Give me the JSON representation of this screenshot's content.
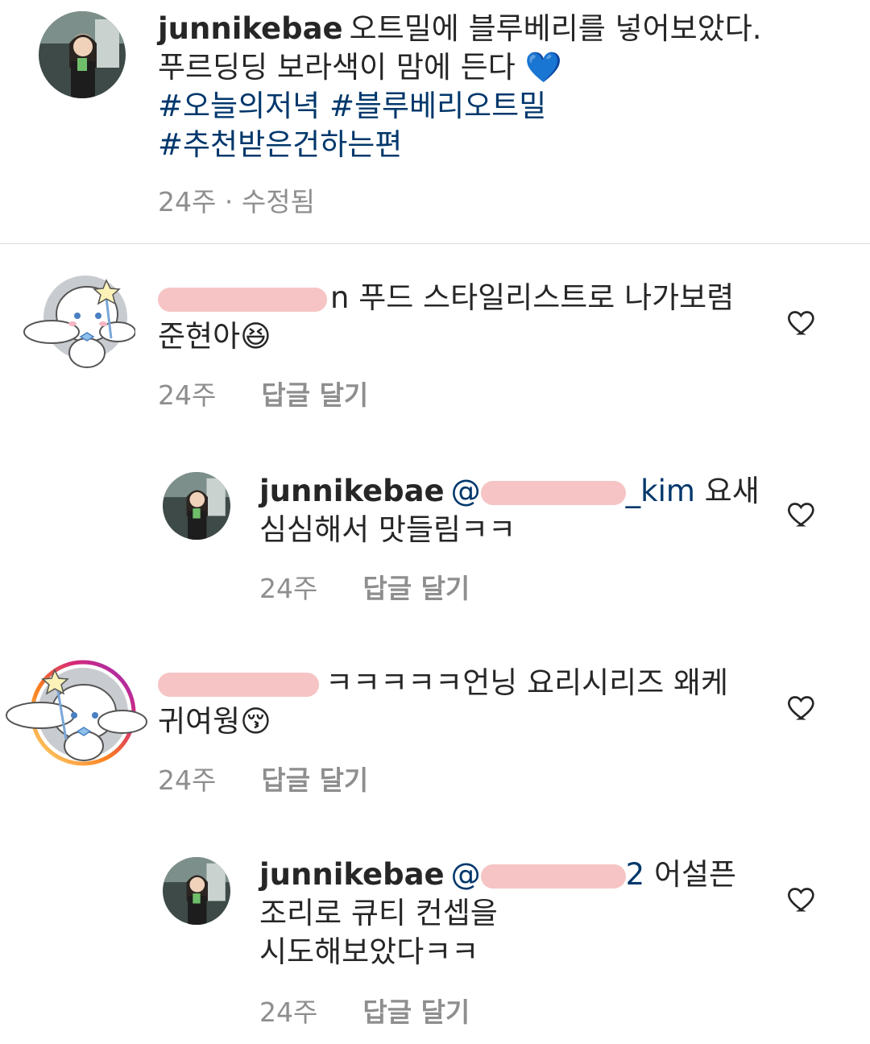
{
  "post": {
    "username": "junnikebae",
    "caption_line1": "오트밀에 블루베리를 넣어보았다.",
    "caption_line2": "푸르딩딩 보라색이 맘에 든다",
    "heart_emoji": "💙",
    "tag1": "#오늘의저녁",
    "tag2": "#블루베리오트밀",
    "tag3": "#추천받은건하는편",
    "time": "24주",
    "sep": "·",
    "edited": "수정됨"
  },
  "comments": [
    {
      "username_visible_end": "n",
      "text_line1": "푸드 스타일리스트로 나가보렴",
      "text_line2": "준현아",
      "emoji": "😆",
      "time": "24주",
      "reply_label": "답글 달기"
    },
    {
      "username": "junnikebae",
      "mention_start": "@",
      "mention_end": "_kim",
      "text_line1": "요새",
      "text_line2": "심심해서 맛들림ㅋㅋ",
      "time": "24주",
      "reply_label": "답글 달기"
    },
    {
      "text_line1": "ㅋㅋㅋㅋㅋ언닝 요리시리즈 왜케",
      "text_line2": "귀여웡",
      "emoji": "😚",
      "time": "24주",
      "reply_label": "답글 달기"
    },
    {
      "username": "junnikebae",
      "mention_start": "@",
      "mention_end": "2",
      "text_line1": "어설픈",
      "text_line2": "조리로 큐티 컨셉을",
      "text_line3": "시도해보았다ㅋㅋ",
      "time": "24주",
      "reply_label": "답글 달기"
    }
  ],
  "colors": {
    "hashtag": "#00376b",
    "meta": "#8e8e8e",
    "redaction": "#f6c4c4"
  },
  "icons": [
    "like-heart-icon",
    "profile-avatar-photo",
    "cinnamoroll-avatar"
  ]
}
